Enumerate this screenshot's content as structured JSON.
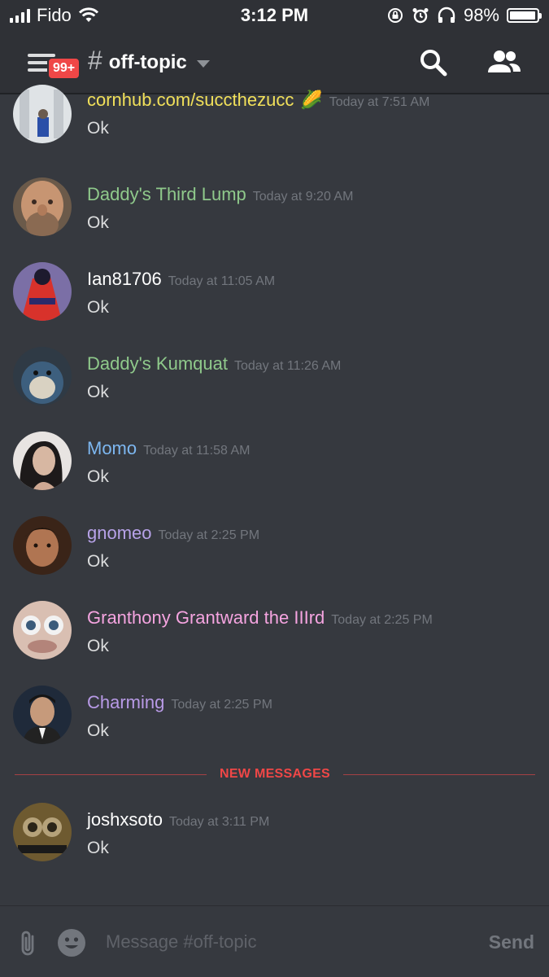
{
  "status_bar": {
    "carrier": "Fido",
    "time": "3:12 PM",
    "battery": "98%",
    "battery_level": 0.98
  },
  "header": {
    "badge": "99+",
    "hash": "#",
    "channel": "off-topic",
    "icons": [
      "menu-icon",
      "search-icon",
      "members-icon"
    ]
  },
  "messages": [
    {
      "username": "cornhub.com/succthezucc",
      "emoji": "🌽",
      "timestamp": "Today at 7:51 AM",
      "text": "Ok",
      "color": "#f1e05a"
    },
    {
      "username": "Daddy's Third Lump",
      "timestamp": "Today at 9:20 AM",
      "text": "Ok",
      "color": "#8fc98b"
    },
    {
      "username": "Ian81706",
      "timestamp": "Today at 11:05 AM",
      "text": "Ok",
      "color": "#ffffff"
    },
    {
      "username": "Daddy's Kumquat",
      "timestamp": "Today at 11:26 AM",
      "text": "Ok",
      "color": "#8fc98b"
    },
    {
      "username": "Momo",
      "timestamp": "Today at 11:58 AM",
      "text": "Ok",
      "color": "#7db7f0"
    },
    {
      "username": "gnomeo",
      "timestamp": "Today at 2:25 PM",
      "text": "Ok",
      "color": "#b7a2e8"
    },
    {
      "username": "Granthony Grantward the IIIrd",
      "timestamp": "Today at 2:25 PM",
      "text": "Ok",
      "color": "#f5a4e0"
    },
    {
      "username": "Charming",
      "timestamp": "Today at 2:25 PM",
      "text": "Ok",
      "color": "#b89ae6"
    },
    {
      "username": "joshxsoto",
      "timestamp": "Today at 3:11 PM",
      "text": "Ok",
      "color": "#ffffff"
    }
  ],
  "divider": {
    "label": "NEW MESSAGES"
  },
  "composer": {
    "placeholder": "Message #off-topic",
    "send_label": "Send"
  }
}
